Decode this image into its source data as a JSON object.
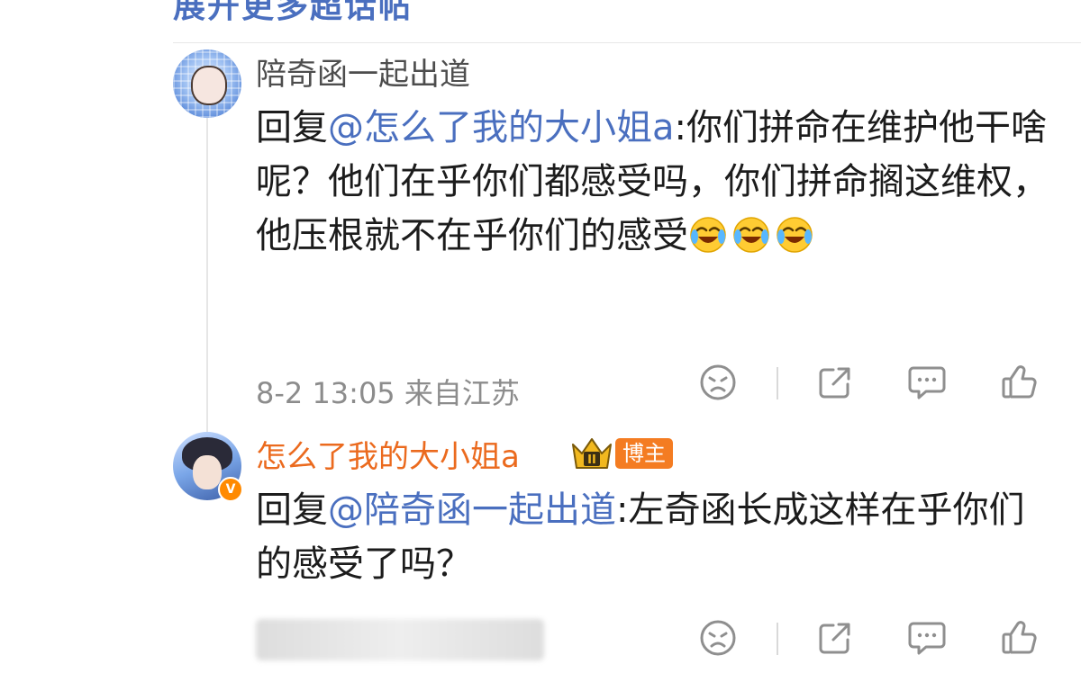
{
  "top_cut_text": "展开更多超话帖",
  "comments": [
    {
      "author": "陪奇函一起出道",
      "reply_prefix": "回复",
      "mention": "@怎么了我的大小姐a",
      "text": ":你们拼命在维护他干啥呢？他们在乎你们都感受吗，你们拼命搁这维权，他压根就不在乎你们的感受",
      "emoji_count": 3,
      "emoji_name": "crying-laughing-emoji",
      "meta": "8-2 13:05 来自江苏"
    },
    {
      "author": "怎么了我的大小姐a",
      "badge_level": "II",
      "blogger_badge": "博主",
      "verified_mark": "V",
      "reply_prefix": "回复",
      "mention": "@陪奇函一起出道",
      "text": ":左奇函长成这样在乎你们的感受了吗？",
      "meta_hidden": true
    }
  ],
  "actions": [
    "dislike-icon",
    "share-icon",
    "comment-icon",
    "like-icon"
  ],
  "colors": {
    "mention": "#4a6fbf",
    "blogger_name": "#eb6a1e",
    "badge": "#f47c22",
    "meta": "#8c8c8c",
    "icon": "#8f8f8f"
  }
}
